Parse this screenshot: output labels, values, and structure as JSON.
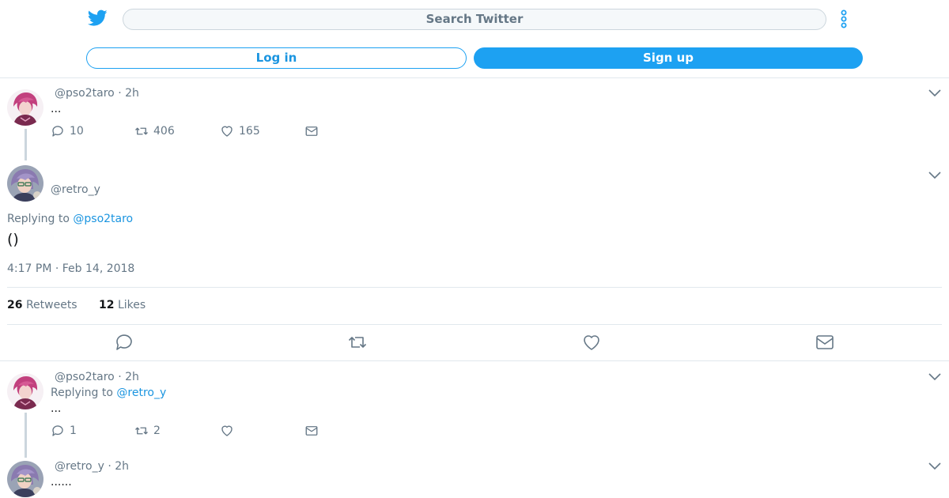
{
  "colors": {
    "accent": "#1da1f2",
    "link": "#1b95e0",
    "muted": "#657786",
    "divider": "#e1e8ed"
  },
  "header": {
    "search_placeholder": "Search Twitter",
    "login_label": "Log in",
    "signup_label": "Sign up"
  },
  "tweets": [
    {
      "handle": "@pso2taro",
      "time": "· 2h",
      "text": "...",
      "replies": "10",
      "retweets": "406",
      "likes": "165"
    },
    {
      "handle": "@pso2taro",
      "time": "· 2h",
      "replying_label": "Replying to",
      "replying_to": "@retro_y",
      "text": "...",
      "replies": "1",
      "retweets": "2"
    },
    {
      "handle": "@retro_y",
      "time": "· 2h",
      "text": "......"
    }
  ],
  "focused": {
    "handle": "@retro_y",
    "replying_label": "Replying to",
    "replying_to": "@pso2taro",
    "text": "()",
    "timestamp": "4:17 PM · Feb 14, 2018",
    "retweets_count": "26",
    "retweets_label": "Retweets",
    "likes_count": "12",
    "likes_label": "Likes"
  }
}
